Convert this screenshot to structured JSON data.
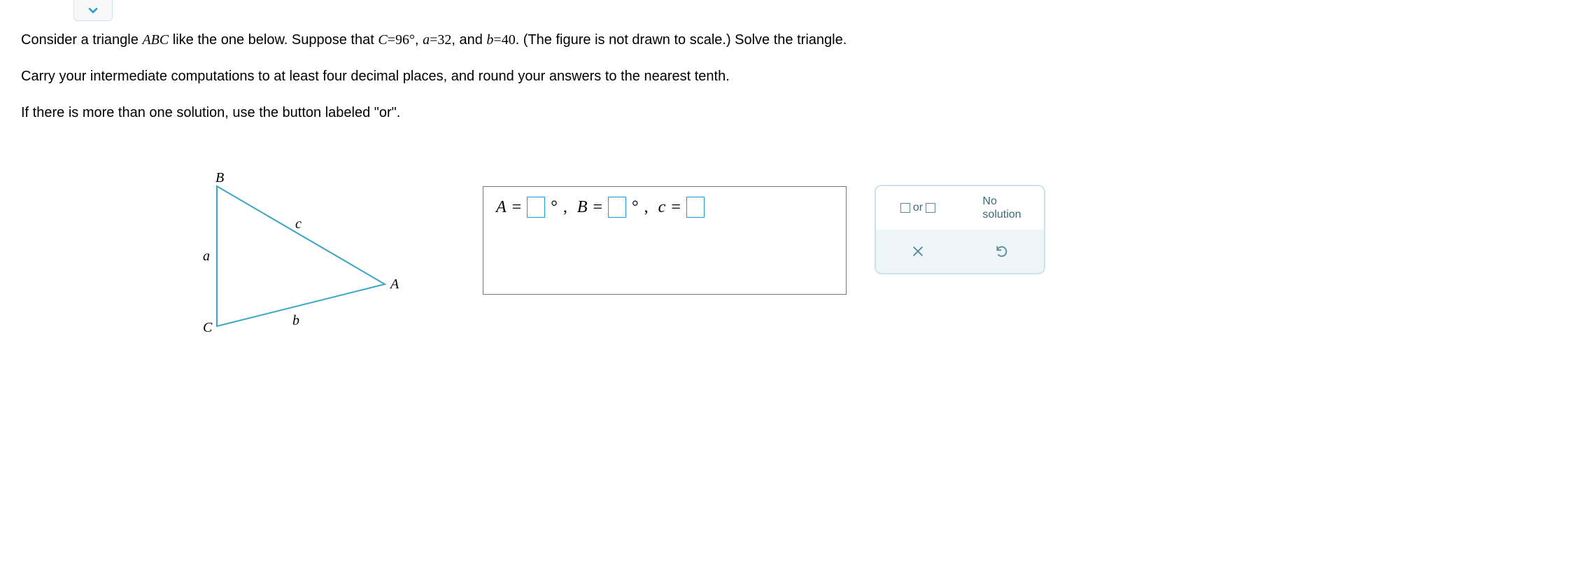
{
  "problem": {
    "line1_pre": "Consider a triangle ",
    "triangle_name": "ABC",
    "line1_mid": " like the one below. Suppose that ",
    "given_C_lhs": "C",
    "given_C_eq": "=",
    "given_C_val": "96°",
    "sep1": ", ",
    "given_a_lhs": "a",
    "given_a_eq": "=",
    "given_a_val": "32",
    "sep2": ", and ",
    "given_b_lhs": "b",
    "given_b_eq": "=",
    "given_b_val": "40",
    "line1_post": ". (The figure is not drawn to scale.) Solve the triangle.",
    "line2": "Carry your intermediate computations to at least four decimal places, and round your answers to the nearest tenth.",
    "line3": "If there is more than one solution, use the button labeled \"or\"."
  },
  "figure": {
    "labels": {
      "A": "A",
      "B": "B",
      "C": "C",
      "a": "a",
      "b": "b",
      "c": "c"
    }
  },
  "answer": {
    "A_label": "A",
    "B_label": "B",
    "c_label": "c",
    "eq": " = ",
    "deg": "°",
    "comma": ",",
    "A_value": "",
    "B_value": "",
    "c_value": ""
  },
  "toolbox": {
    "or_label": "or",
    "no_solution_label": "No\nsolution"
  }
}
